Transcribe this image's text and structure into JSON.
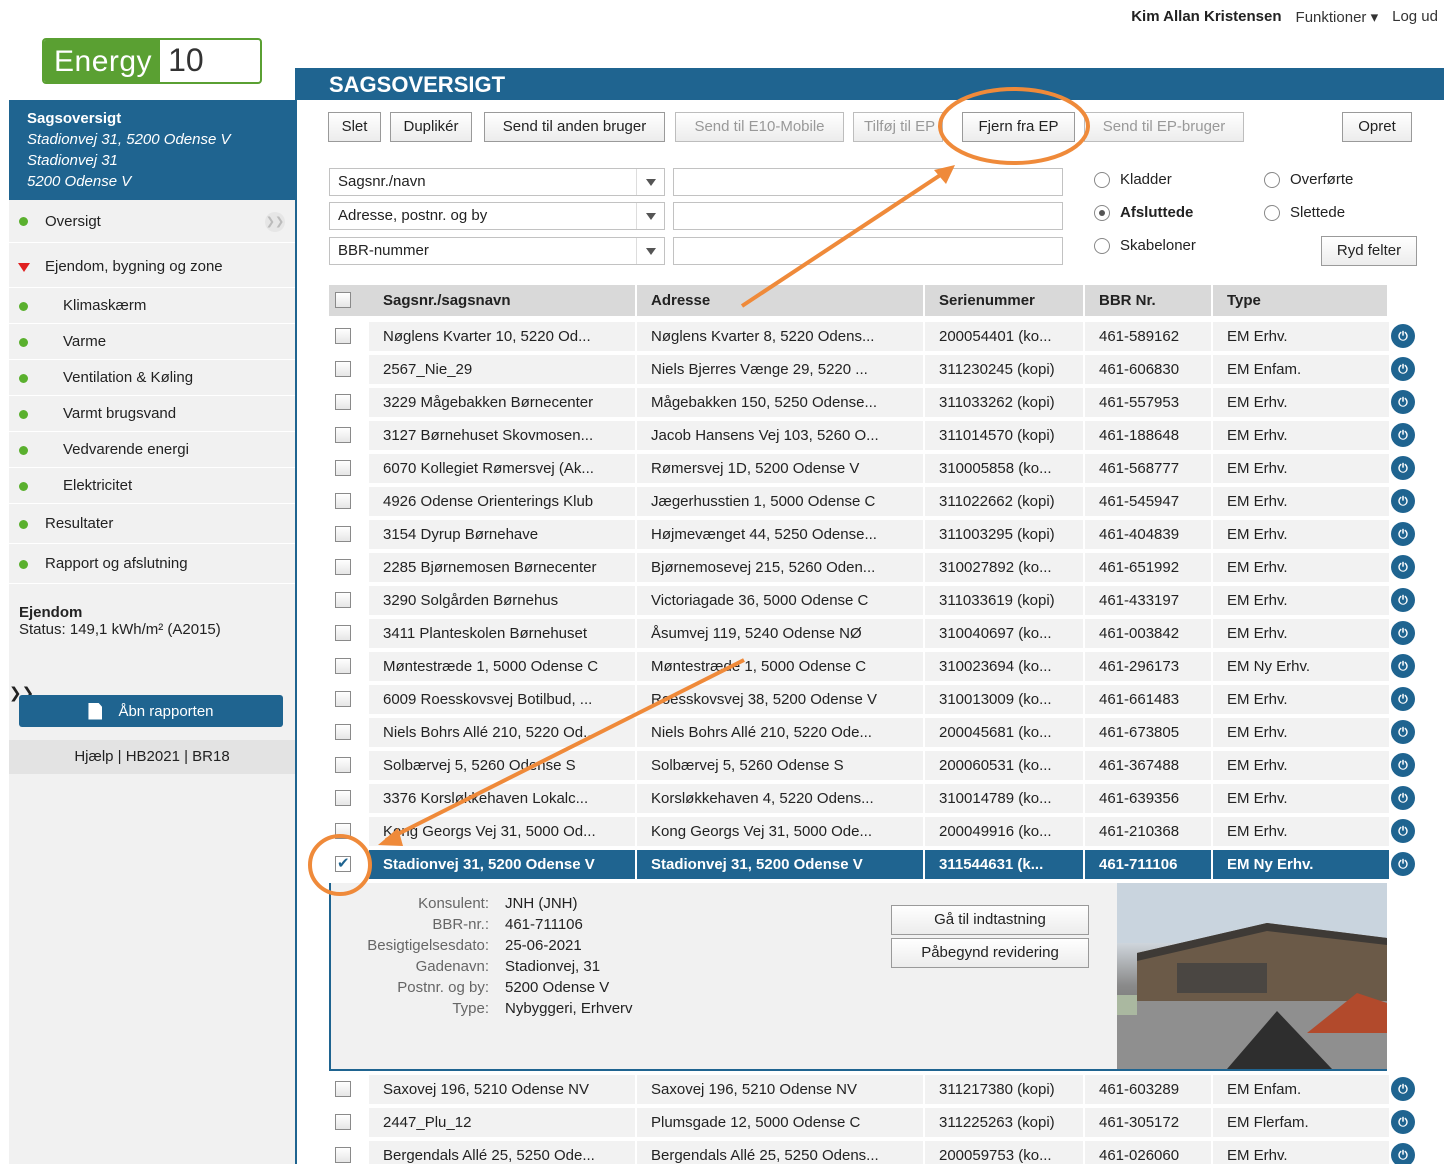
{
  "topbar": {
    "user": "Kim Allan Kristensen",
    "functions": "Funktioner ▾",
    "logout": "Log ud"
  },
  "logo": {
    "part1": "Energy",
    "part2": "10"
  },
  "sidebar": {
    "head": {
      "title": "Sagsoversigt",
      "line1": "Stadionvej 31, 5200 Odense V",
      "line2": "Stadionvej 31",
      "line3": "5200 Odense V"
    },
    "items": [
      {
        "label": "Oversigt",
        "type": "main"
      },
      {
        "label": "Ejendom, bygning og zone",
        "type": "main-open"
      },
      {
        "label": "Klimaskærm",
        "type": "sub"
      },
      {
        "label": "Varme",
        "type": "sub"
      },
      {
        "label": "Ventilation & Køling",
        "type": "sub"
      },
      {
        "label": "Varmt brugsvand",
        "type": "sub"
      },
      {
        "label": "Vedvarende energi",
        "type": "sub"
      },
      {
        "label": "Elektricitet",
        "type": "sub"
      },
      {
        "label": "Resultater",
        "type": "main"
      },
      {
        "label": "Rapport og afslutning",
        "type": "main"
      }
    ],
    "status_title": "Ejendom",
    "status_text": "Status: 149,1 kWh/m² (A2015)",
    "report_button": "Åbn rapporten",
    "links": "Hjælp | HB2021 | BR18"
  },
  "main": {
    "title": "SAGSOVERSIGT",
    "toolbar": {
      "delete": "Slet",
      "duplicate": "Duplikér",
      "send_other": "Send til anden bruger",
      "send_mobile": "Send til E10-Mobile",
      "add_ep": "Tilføj til EP",
      "remove_ep": "Fjern fra EP",
      "send_ep_user": "Send til EP-bruger",
      "create": "Opret"
    },
    "filters": {
      "selects": [
        "Sagsnr./navn",
        "Adresse, postnr. og by",
        "BBR-nummer"
      ],
      "radios": [
        {
          "label": "Kladder",
          "checked": false
        },
        {
          "label": "Overførte",
          "checked": false
        },
        {
          "label": "Afsluttede",
          "checked": true
        },
        {
          "label": "Slettede",
          "checked": false
        },
        {
          "label": "Skabeloner",
          "checked": false
        }
      ],
      "clear_button": "Ryd felter"
    },
    "table": {
      "headers": [
        "Sagsnr./sagsnavn",
        "Adresse",
        "Serienummer",
        "BBR Nr.",
        "Type"
      ],
      "rows": [
        [
          "Nøglens Kvarter 10, 5220 Od...",
          "Nøglens Kvarter 8, 5220 Odens...",
          "200054401 (ko...",
          "461-589162",
          "EM Erhv."
        ],
        [
          "2567_Nie_29",
          "Niels Bjerres Vænge 29, 5220 ...",
          "311230245 (kopi)",
          "461-606830",
          "EM Enfam."
        ],
        [
          "3229 Mågebakken Børnecenter",
          "Mågebakken 150, 5250 Odense...",
          "311033262 (kopi)",
          "461-557953",
          "EM Erhv."
        ],
        [
          "3127 Børnehuset Skovmosen...",
          "Jacob Hansens Vej 103, 5260 O...",
          "311014570 (kopi)",
          "461-188648",
          "EM Erhv."
        ],
        [
          "6070 Kollegiet Rømersvej (Ak...",
          "Rømersvej 1D, 5200 Odense V",
          "310005858 (ko...",
          "461-568777",
          "EM Erhv."
        ],
        [
          "4926 Odense Orienterings Klub",
          "Jægerhusstien 1, 5000 Odense C",
          "311022662 (kopi)",
          "461-545947",
          "EM Erhv."
        ],
        [
          "3154 Dyrup Børnehave",
          "Højmevænget 44, 5250 Odense...",
          "311003295 (kopi)",
          "461-404839",
          "EM Erhv."
        ],
        [
          "2285 Bjørnemosen Børnecenter",
          "Bjørnemosevej 215, 5260 Oden...",
          "310027892 (ko...",
          "461-651992",
          "EM Erhv."
        ],
        [
          "3290 Solgården Børnehus",
          "Victoriagade 36, 5000 Odense C",
          "311033619 (kopi)",
          "461-433197",
          "EM Erhv."
        ],
        [
          "3411 Planteskolen Børnehuset",
          "Åsumvej 119, 5240 Odense NØ",
          "310040697 (ko...",
          "461-003842",
          "EM Erhv."
        ],
        [
          "Møntestræde 1, 5000 Odense C",
          "Møntestræde 1, 5000 Odense C",
          "310023694 (ko...",
          "461-296173",
          "EM Ny Erhv."
        ],
        [
          "6009 Roesskovsvej Botilbud, ...",
          "Roesskovsvej 38, 5200 Odense V",
          "310013009 (ko...",
          "461-661483",
          "EM Erhv."
        ],
        [
          "Niels Bohrs Allé 210, 5220 Od...",
          "Niels Bohrs Allé 210, 5220 Ode...",
          "200045681 (ko...",
          "461-673805",
          "EM Erhv."
        ],
        [
          "Solbærvej 5, 5260 Odense S",
          "Solbærvej 5, 5260 Odense S",
          "200060531 (ko...",
          "461-367488",
          "EM Erhv."
        ],
        [
          "3376 Korsløkkehaven Lokalc...",
          "Korsløkkehaven 4, 5220 Odens...",
          "310014789 (ko...",
          "461-639356",
          "EM Erhv."
        ],
        [
          "Kong Georgs Vej 31, 5000 Od...",
          "Kong Georgs Vej 31, 5000 Ode...",
          "200049916 (ko...",
          "461-210368",
          "EM Erhv."
        ]
      ],
      "selected_row": [
        "Stadionvej 31, 5200 Odense V",
        "Stadionvej 31, 5200 Odense V",
        "311544631 (k...",
        "461-711106",
        "EM Ny Erhv."
      ],
      "rows_after": [
        [
          "Saxovej 196, 5210 Odense NV",
          "Saxovej 196, 5210 Odense NV",
          "311217380 (kopi)",
          "461-603289",
          "EM Enfam."
        ],
        [
          "2447_Plu_12",
          "Plumsgade 12, 5000 Odense C",
          "311225263 (kopi)",
          "461-305172",
          "EM Flerfam."
        ],
        [
          "Bergendals Allé 25, 5250 Ode...",
          "Bergendals Allé 25, 5250 Odens...",
          "200059753 (ko...",
          "461-026060",
          "EM Erhv."
        ]
      ]
    },
    "detail": {
      "labels": [
        "Konsulent:",
        "BBR-nr.:",
        "Besigtigelsesdato:",
        "Gadenavn:",
        "Postnr. og by:",
        "Type:"
      ],
      "values": [
        "JNH (JNH)",
        "461-711106",
        "25-06-2021",
        "Stadionvej, 31",
        "5200 Odense V",
        "Nybyggeri, Erhverv"
      ],
      "go_button": "Gå til indtastning",
      "revise_button": "Påbegynd revidering"
    }
  },
  "colors": {
    "primary": "#1f6490",
    "green": "#5ab02e",
    "annotation": "#ef8a3a"
  }
}
